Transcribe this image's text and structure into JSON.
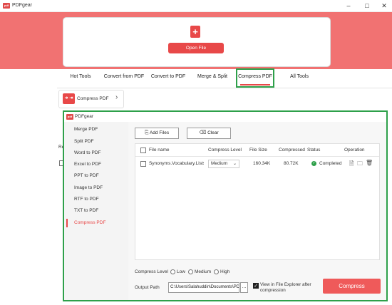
{
  "app": {
    "title": "PDFgear",
    "logo_text": "pdf"
  },
  "window_controls": {
    "minimize": "–",
    "maximize": "□",
    "close": "✕"
  },
  "open": {
    "plus": "+",
    "label": "Open File"
  },
  "tabs": [
    {
      "label": "Hot Tools"
    },
    {
      "label": "Convert from PDF"
    },
    {
      "label": "Convert to PDF"
    },
    {
      "label": "Merge & Split"
    },
    {
      "label": "Compress PDF"
    },
    {
      "label": "All Tools"
    }
  ],
  "subtool": {
    "icon_text": "➜ ⇥",
    "label": "Compress PDF",
    "chevron": "›"
  },
  "background_fragment": {
    "text": "Rec"
  },
  "dialog": {
    "title": "PDFgear",
    "sidebar": [
      {
        "label": "Merge PDF"
      },
      {
        "label": "Split PDF"
      },
      {
        "label": "Word to PDF"
      },
      {
        "label": "Excel to PDF"
      },
      {
        "label": "PPT to PDF"
      },
      {
        "label": "Image to PDF"
      },
      {
        "label": "RTF to PDF"
      },
      {
        "label": "TXT to PDF"
      },
      {
        "label": "Compress PDF"
      }
    ],
    "toolbar": {
      "add_files": "Add Files",
      "clear": "Clear"
    },
    "table": {
      "headers": [
        "File name",
        "Compress Level",
        "File Size",
        "Compressed S",
        "Status",
        "Operation"
      ],
      "rows": [
        {
          "file": "Synonyms.Vocabulary.Lists.pdf",
          "level": "Medium",
          "size": "160.34K",
          "compressed": "80.72K",
          "status": "Completed"
        }
      ]
    },
    "compress_level": {
      "label": "Compress Level",
      "options": [
        "Low",
        "Medium",
        "High"
      ]
    },
    "output": {
      "label": "Output Path",
      "path": "C:\\Users\\Salahuddin\\Documents\\PDFgear",
      "browse": "...",
      "view_label": "View in File Explorer after compression"
    },
    "compress_button": "Compress"
  }
}
